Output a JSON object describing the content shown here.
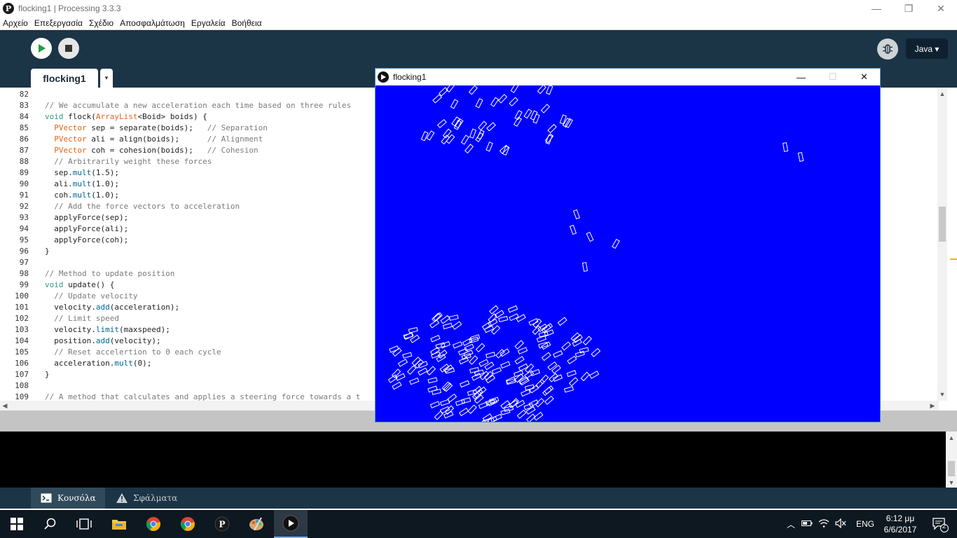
{
  "window": {
    "title": "flocking1 | Processing 3.3.3",
    "app_icon_glyph": "P",
    "controls": {
      "minimize": "—",
      "maximize": "❐",
      "close": "✕"
    }
  },
  "menu": {
    "items": [
      "Αρχείο",
      "Επεξεργασία",
      "Σχέδιο",
      "Αποσφαλμάτωση",
      "Εργαλεία",
      "Βοήθεια"
    ]
  },
  "toolbar": {
    "mode_label": "Java ▾"
  },
  "tabs": {
    "active_label": "flocking1",
    "menu_arrow": "▾"
  },
  "editor": {
    "lines": [
      {
        "n": "82",
        "tokens": []
      },
      {
        "n": "83",
        "tokens": [
          {
            "t": "comment",
            "v": "// We accumulate a new acceleration each time based on three rules"
          }
        ]
      },
      {
        "n": "84",
        "tokens": [
          {
            "t": "key",
            "v": "void"
          },
          {
            "t": "plain",
            "v": " flock("
          },
          {
            "t": "type",
            "v": "ArrayList"
          },
          {
            "t": "plain",
            "v": "<Boid> boids) {"
          }
        ]
      },
      {
        "n": "85",
        "tokens": [
          {
            "t": "plain",
            "v": "  "
          },
          {
            "t": "type",
            "v": "PVector"
          },
          {
            "t": "plain",
            "v": " sep = separate(boids);   "
          },
          {
            "t": "comment",
            "v": "// Separation"
          }
        ]
      },
      {
        "n": "86",
        "tokens": [
          {
            "t": "plain",
            "v": "  "
          },
          {
            "t": "type",
            "v": "PVector"
          },
          {
            "t": "plain",
            "v": " ali = align(boids);      "
          },
          {
            "t": "comment",
            "v": "// Alignment"
          }
        ]
      },
      {
        "n": "87",
        "tokens": [
          {
            "t": "plain",
            "v": "  "
          },
          {
            "t": "type",
            "v": "PVector"
          },
          {
            "t": "plain",
            "v": " coh = cohesion(boids);   "
          },
          {
            "t": "comment",
            "v": "// Cohesion"
          }
        ]
      },
      {
        "n": "88",
        "tokens": [
          {
            "t": "plain",
            "v": "  "
          },
          {
            "t": "comment",
            "v": "// Arbitrarily weight these forces"
          }
        ]
      },
      {
        "n": "89",
        "tokens": [
          {
            "t": "plain",
            "v": "  sep."
          },
          {
            "t": "fn",
            "v": "mult"
          },
          {
            "t": "plain",
            "v": "(1.5);"
          }
        ]
      },
      {
        "n": "90",
        "tokens": [
          {
            "t": "plain",
            "v": "  ali."
          },
          {
            "t": "fn",
            "v": "mult"
          },
          {
            "t": "plain",
            "v": "(1.0);"
          }
        ]
      },
      {
        "n": "91",
        "tokens": [
          {
            "t": "plain",
            "v": "  coh."
          },
          {
            "t": "fn",
            "v": "mult"
          },
          {
            "t": "plain",
            "v": "(1.0);"
          }
        ]
      },
      {
        "n": "92",
        "tokens": [
          {
            "t": "plain",
            "v": "  "
          },
          {
            "t": "comment",
            "v": "// Add the force vectors to acceleration"
          }
        ]
      },
      {
        "n": "93",
        "tokens": [
          {
            "t": "plain",
            "v": "  applyForce(sep);"
          }
        ]
      },
      {
        "n": "94",
        "tokens": [
          {
            "t": "plain",
            "v": "  applyForce(ali);"
          }
        ]
      },
      {
        "n": "95",
        "tokens": [
          {
            "t": "plain",
            "v": "  applyForce(coh);"
          }
        ]
      },
      {
        "n": "96",
        "tokens": [
          {
            "t": "plain",
            "v": "}"
          }
        ]
      },
      {
        "n": "97",
        "tokens": []
      },
      {
        "n": "98",
        "tokens": [
          {
            "t": "comment",
            "v": "// Method to update position"
          }
        ]
      },
      {
        "n": "99",
        "tokens": [
          {
            "t": "key",
            "v": "void"
          },
          {
            "t": "plain",
            "v": " update() {"
          }
        ]
      },
      {
        "n": "100",
        "tokens": [
          {
            "t": "plain",
            "v": "  "
          },
          {
            "t": "comment",
            "v": "// Update velocity"
          }
        ]
      },
      {
        "n": "101",
        "tokens": [
          {
            "t": "plain",
            "v": "  velocity."
          },
          {
            "t": "fn",
            "v": "add"
          },
          {
            "t": "plain",
            "v": "(acceleration);"
          }
        ]
      },
      {
        "n": "102",
        "tokens": [
          {
            "t": "plain",
            "v": "  "
          },
          {
            "t": "comment",
            "v": "// Limit speed"
          }
        ]
      },
      {
        "n": "103",
        "tokens": [
          {
            "t": "plain",
            "v": "  velocity."
          },
          {
            "t": "fn",
            "v": "limit"
          },
          {
            "t": "plain",
            "v": "(maxspeed);"
          }
        ]
      },
      {
        "n": "104",
        "tokens": [
          {
            "t": "plain",
            "v": "  position."
          },
          {
            "t": "fn",
            "v": "add"
          },
          {
            "t": "plain",
            "v": "(velocity);"
          }
        ]
      },
      {
        "n": "105",
        "tokens": [
          {
            "t": "plain",
            "v": "  "
          },
          {
            "t": "comment",
            "v": "// Reset accelertion to 0 each cycle"
          }
        ]
      },
      {
        "n": "106",
        "tokens": [
          {
            "t": "plain",
            "v": "  acceleration."
          },
          {
            "t": "fn",
            "v": "mult"
          },
          {
            "t": "plain",
            "v": "(0);"
          }
        ]
      },
      {
        "n": "107",
        "tokens": [
          {
            "t": "plain",
            "v": "}"
          }
        ]
      },
      {
        "n": "108",
        "tokens": []
      },
      {
        "n": "109",
        "tokens": [
          {
            "t": "comment",
            "v": "// A method that calculates and applies a steering force towards a t"
          }
        ]
      }
    ]
  },
  "footer": {
    "console_label": "Κονσόλα",
    "errors_label": "Σφάλματα"
  },
  "sketch_window": {
    "title": "flocking1",
    "controls": {
      "minimize": "—",
      "maximize": "☐",
      "close": "✕"
    }
  },
  "taskbar": {
    "language": "ENG",
    "time": "6:12 μμ",
    "date": "6/6/2017",
    "notification_count": "2"
  },
  "colors": {
    "ide_bg": "#1b3446",
    "canvas_bg": "#0000ff",
    "boid_stroke": "#ffffff",
    "comment": "#7b7b7b",
    "keyword": "#33997e",
    "type": "#e2661a",
    "function": "#006699"
  }
}
